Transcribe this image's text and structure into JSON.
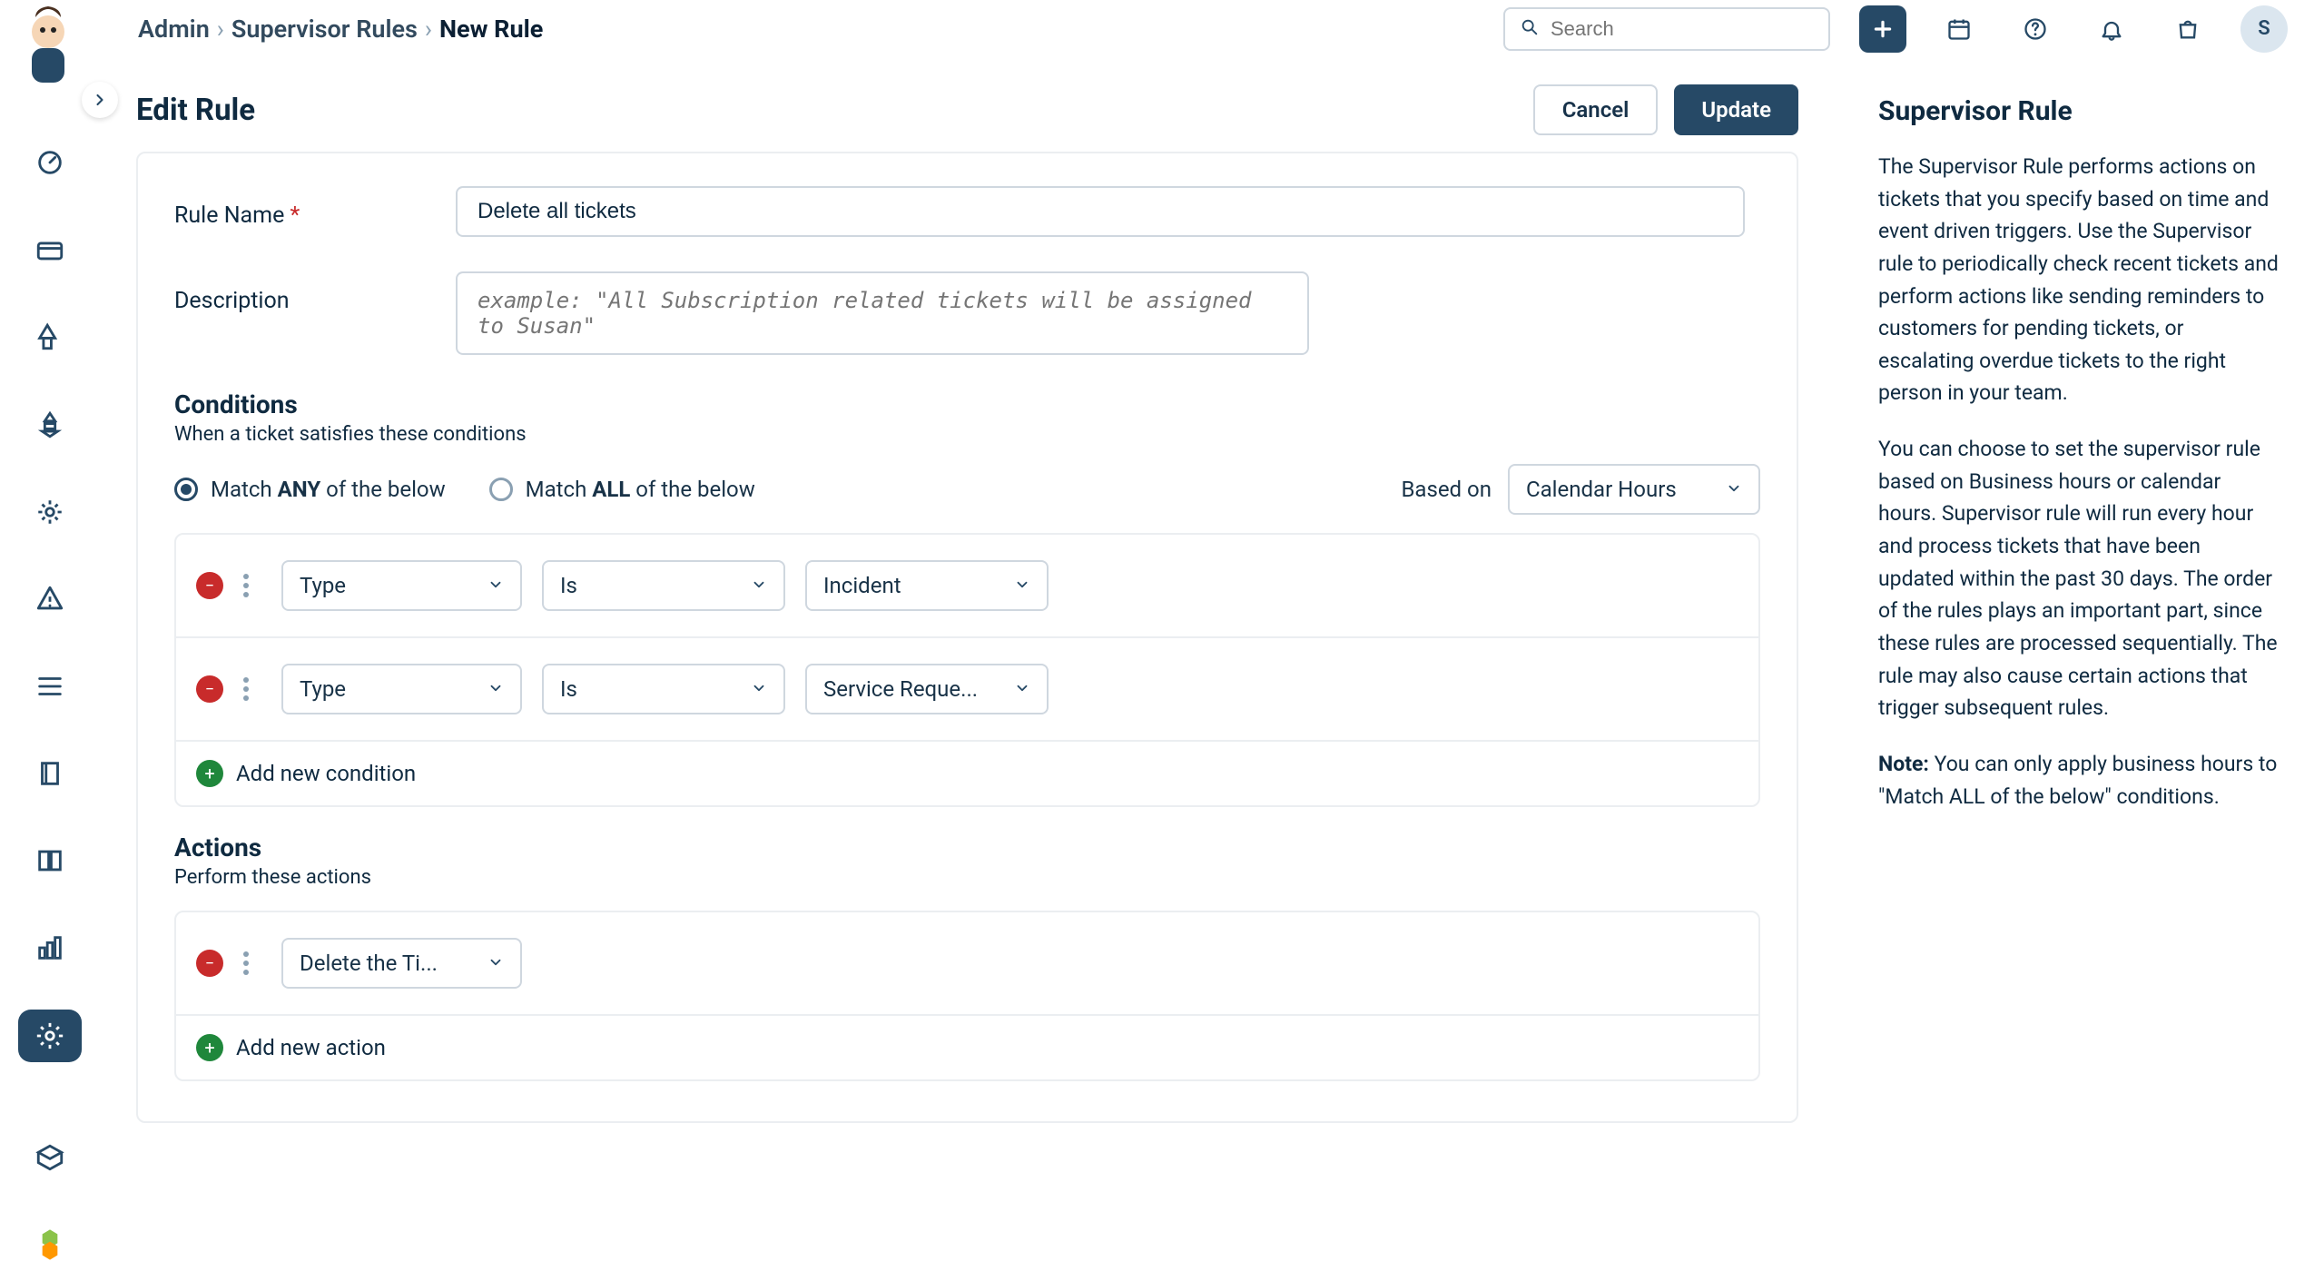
{
  "breadcrumbs": {
    "admin": "Admin",
    "supervisor_rules": "Supervisor Rules",
    "current": "New Rule"
  },
  "search": {
    "placeholder": "Search"
  },
  "avatar_initial": "S",
  "main": {
    "title": "Edit Rule",
    "cancel": "Cancel",
    "update": "Update",
    "rule_name_label": "Rule Name ",
    "rule_name_value": "Delete all tickets",
    "description_label": "Description",
    "description_placeholder": "example: \"All Subscription related tickets will be assigned to Susan\"",
    "conditions": {
      "title": "Conditions",
      "subtitle": "When a ticket satisfies these conditions",
      "match_any_pre": "Match ",
      "match_any_bold": "ANY",
      "match_any_post": " of the below",
      "match_all_pre": "Match ",
      "match_all_bold": "ALL",
      "match_all_post": " of the below",
      "based_on_label": "Based on",
      "based_on_value": "Calendar Hours",
      "rows": [
        {
          "field": "Type",
          "operator": "Is",
          "value": "Incident"
        },
        {
          "field": "Type",
          "operator": "Is",
          "value": "Service Reque..."
        }
      ],
      "add_label": "Add new condition"
    },
    "actions": {
      "title": "Actions",
      "subtitle": "Perform these actions",
      "rows": [
        {
          "action": "Delete the Ti..."
        }
      ],
      "add_label": "Add new action"
    }
  },
  "help": {
    "title": "Supervisor Rule",
    "p1": "The Supervisor Rule performs actions on tickets that you specify based on time and event driven triggers. Use the Supervisor rule to periodically check recent tickets and perform actions like sending reminders to customers for pending tickets, or escalating overdue tickets to the right person in your team.",
    "p2": "You can choose to set the supervisor rule based on Business hours or calendar hours. Supervisor rule will run every hour and process tickets that have been updated within the past 30 days. The order of the rules plays an important part, since these rules are processed sequentially. The rule may also cause certain actions that trigger subsequent rules.",
    "note_label": "Note:",
    "note_text": " You can only apply business hours to \"Match ALL of the below\" conditions."
  }
}
